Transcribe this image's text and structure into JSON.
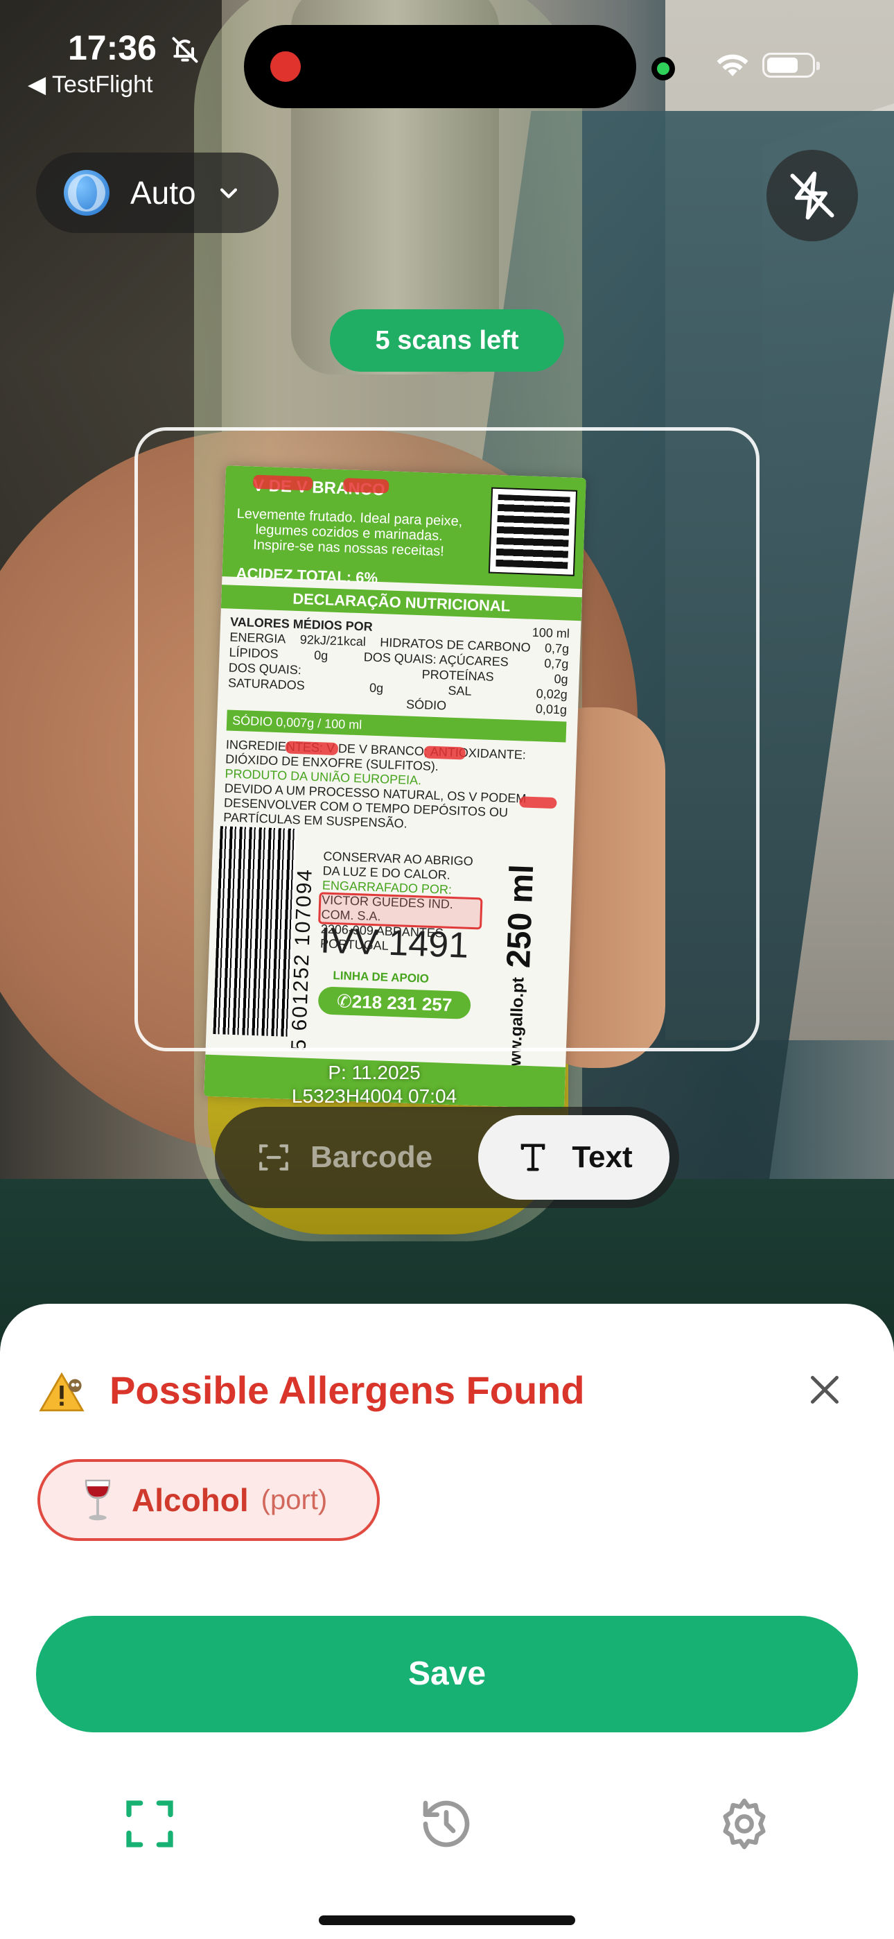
{
  "status_bar": {
    "time": "17:36",
    "back_app": "◀ TestFlight",
    "icons": [
      "bell-slash-icon",
      "recording-indicator",
      "camera-in-use-dot",
      "wifi-icon",
      "battery-icon"
    ]
  },
  "camera": {
    "language": {
      "label": "Auto",
      "icon": "globe-icon"
    },
    "flash_icon": "flash-off-icon",
    "scans_left": "5 scans left",
    "modes": [
      {
        "label": "Barcode",
        "icon": "barcode-scan-icon",
        "selected": false
      },
      {
        "label": "Text",
        "icon": "text-icon",
        "selected": true
      }
    ]
  },
  "label_text": {
    "title": "V DE V BRANCO",
    "description": "Levemente frutado. Ideal para peixe, legumes cozidos e marinadas. Inspire-se nas nossas receitas!",
    "acidez": "ACIDEZ TOTAL: 6%",
    "declaracao": "DECLARAÇÃO NUTRICIONAL",
    "valores": "VALORES MÉDIOS POR",
    "per": "100 ml",
    "rows": [
      [
        "ENERGIA",
        "92kJ/21kcal",
        "HIDRATOS DE CARBONO",
        "0,7g"
      ],
      [
        "LÍPIDOS",
        "0g",
        "DOS QUAIS: AÇÚCARES",
        "0,7g"
      ],
      [
        "DOS QUAIS:",
        "",
        "PROTEÍNAS",
        "0g"
      ],
      [
        "SATURADOS",
        "0g",
        "SAL",
        "0,02g"
      ],
      [
        "",
        "",
        "SÓDIO",
        "0,01g"
      ]
    ],
    "sodio": "SÓDIO 0,007g / 100 ml",
    "ingredientes": "INGREDIENTES: V DE V BRANCO; ANTIOXIDANTE: DIÓXIDO DE ENXOFRE (SULFITOS).",
    "origem": "PRODUTO DA UNIÃO EUROPEIA.",
    "aviso": "DEVIDO A UM PROCESSO NATURAL, OS V PODEM DESENVOLVER COM O TEMPO DEPÓSITOS OU PARTÍCULAS EM SUSPENSÃO.",
    "conservar": "CONSERVAR AO ABRIGO DA LUZ E DO CALOR.",
    "engarrafado": "ENGARRAFADO POR:",
    "empresa": "VICTOR GUEDES IND. COM. S.A.",
    "morada": "2206-909 ABRANTES PORTUGAL",
    "ivv": "IVV 1491",
    "apoio": "LINHA DE APOIO",
    "telefone": "✆218 231 257",
    "site": "www.gallo.pt",
    "volume": "250 ml",
    "barcode_number": "5 601252 107094",
    "lote": "P: 11.2025",
    "lote2": "L5323H4004  07:04"
  },
  "sheet": {
    "warning_icon": "warning-owl-icon",
    "title": "Possible Allergens Found",
    "close_icon": "close-icon",
    "allergens": [
      {
        "label": "Alcohol",
        "note": "(port)",
        "icon": "wine-glass-icon"
      }
    ],
    "save_label": "Save",
    "nav": [
      {
        "name": "scan",
        "icon": "scan-frame-icon",
        "active": true
      },
      {
        "name": "history",
        "icon": "history-icon",
        "active": false
      },
      {
        "name": "settings",
        "icon": "gear-icon",
        "active": false
      }
    ]
  },
  "colors": {
    "accent_green": "#16b173",
    "scans_pill_green": "#1fae64",
    "danger_red": "#d9352b",
    "chip_bg": "#fde9e7",
    "chip_border": "#e14a40"
  }
}
